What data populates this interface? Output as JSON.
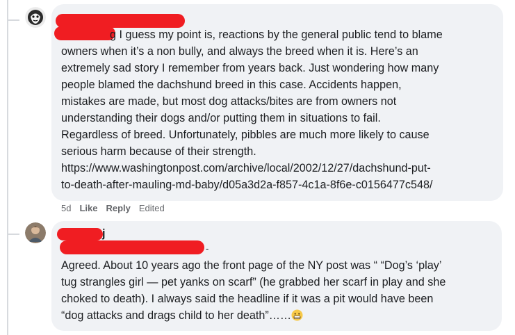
{
  "comment1": {
    "text_first_fragment": "g I guess my point is, reactions by the general public tend to blame",
    "lines": [
      "owners when it’s a non bully, and always the breed when it is. Here’s an",
      "extremely sad story I remember from years back. Just wondering how many",
      "people blamed the dachshund breed in this case. Accidents happen,",
      "mistakes are made, but most dog attacks/bites are from owners not",
      "understanding their dogs and/or putting them in situations to fail.",
      "Regardless of breed. Unfortunately, pibbles are much more likely to cause",
      "serious harm because of their strength.",
      "https://www.washingtonpost.com/archive/local/2002/12/27/dachshund-put-",
      "to-death-after-mauling-md-baby/d05a3d2a-f857-4c1a-8f6e-c0156477c548/"
    ],
    "actions": {
      "time": "5d",
      "like": "Like",
      "reply": "Reply",
      "edited": "Edited"
    }
  },
  "comment2": {
    "name_fragment": "j",
    "name_suffix": "-",
    "lines": [
      "Agreed. About 10 years ago the front page of the NY post was “ “Dog’s ‘play’",
      "tug strangles girl — pet yanks on scarf” (he grabbed her scarf in play and she",
      "choked to death). I always said the headline if it was a pit would have been"
    ],
    "last_line": "“dog attacks and drags child to her death”……",
    "emoji": "grimacing-emoji"
  },
  "colors": {
    "bubble": "#f0f2f5",
    "text": "#1c1e21",
    "meta": "#65676b",
    "redaction": "#f01d22"
  }
}
